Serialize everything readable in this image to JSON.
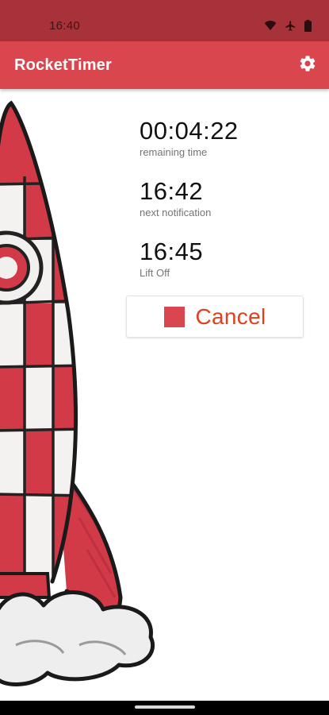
{
  "status_bar": {
    "time": "16:40",
    "icons": [
      "wifi-icon",
      "airplane-icon",
      "battery-icon"
    ]
  },
  "app_bar": {
    "title": "RocketTimer",
    "settings_icon": "gear-icon"
  },
  "timer": {
    "remaining_value": "00:04:22",
    "remaining_label": "remaining time",
    "notification_value": "16:42",
    "notification_label": "next notification",
    "liftoff_value": "16:45",
    "liftoff_label": "Lift Off"
  },
  "cancel_button": {
    "label": "Cancel",
    "icon": "stop-icon"
  },
  "colors": {
    "status_bar": "#a8323a",
    "app_bar": "#d9464d",
    "accent": "#e0401e",
    "rocket_red": "#d23a48"
  }
}
